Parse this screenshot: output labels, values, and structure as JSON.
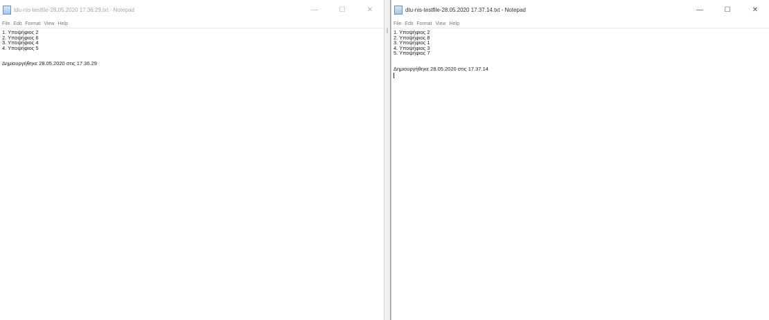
{
  "left_window": {
    "title": "tdu-nis-testfile-28.05.2020 17.36.29.txt - Notepad",
    "controls": {
      "minimize": "—",
      "maximize": "☐",
      "close": "✕"
    },
    "menu": [
      "File",
      "Edit",
      "Format",
      "View",
      "Help"
    ],
    "lines": [
      "1. Υποψήφιος 2",
      "2. Υποψήφιος 6",
      "3. Υποψήφιος 4",
      "4. Υποψήφιος 5"
    ],
    "footer": "Δημιουργήθηκε 28.05.2020 στις 17.36.29"
  },
  "right_window": {
    "title": "dtu-nis-testfile-28.05.2020 17.37.14.txt - Notepad",
    "controls": {
      "minimize": "—",
      "maximize": "☐",
      "close": "✕"
    },
    "menu": [
      "File",
      "Edit",
      "Format",
      "View",
      "Help"
    ],
    "lines": [
      "1. Υποψήφιος 2",
      "2. Υποψήφιος 8",
      "3. Υποψήφιος 1",
      "4. Υποψήφιος 3",
      "5. Υποψήφιος 7"
    ],
    "footer": "Δημιουργήθηκε 28.05.2020 στις 17.37.14"
  }
}
